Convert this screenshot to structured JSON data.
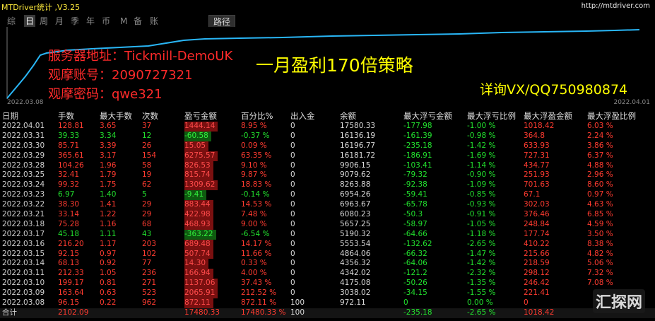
{
  "window": {
    "title": "MTDriver统计 ,V3.25",
    "url": "http://mtdriver.com"
  },
  "tabs": [
    "综",
    "日",
    "周",
    "月",
    "季",
    "年",
    "币",
    "M",
    "备",
    "账户"
  ],
  "active_tab": 1,
  "path_button": "路径",
  "overlay": {
    "server": "服务器地址：Tickmill-DemoUK",
    "account": "观摩账号：2090727321",
    "password": "观摩密码：qwe321",
    "headline": "一月盈利170倍策略",
    "contact": "详询VX/QQ750980874"
  },
  "equity_chart": {
    "start_date": "2022.03.08",
    "end_date": "2022.04.01",
    "line_color": "#29b6f6"
  },
  "table": {
    "headers": [
      "日期",
      "手数",
      "最大手数",
      "次数",
      "盈亏金额",
      "百分比%",
      "出入金",
      "余额",
      "最大浮亏金额",
      "最大浮亏比例",
      "最大浮盈金额",
      "最大浮盈比例"
    ],
    "rows": [
      [
        "2022.04.01",
        "128.81",
        "3.65",
        "37",
        "1444.14",
        "8.95 %",
        "0",
        "17580.33",
        "-177.98",
        "-1.00 %",
        "1018.42",
        "6.03 %"
      ],
      [
        "2022.03.31",
        "39.33",
        "3.34",
        "12",
        "-60.58",
        "-0.37 %",
        "0",
        "16136.19",
        "-161.39",
        "-0.98 %",
        "364.8",
        "2.24 %"
      ],
      [
        "2022.03.30",
        "85.71",
        "3.39",
        "26",
        "15.05",
        "0.09 %",
        "0",
        "16196.77",
        "-235.18",
        "-1.42 %",
        "633.93",
        "3.86 %"
      ],
      [
        "2022.03.29",
        "365.61",
        "3.17",
        "154",
        "6275.57",
        "63.35 %",
        "0",
        "16181.72",
        "-186.91",
        "-1.69 %",
        "727.31",
        "6.37 %"
      ],
      [
        "2022.03.28",
        "104.26",
        "1.96",
        "58",
        "826.53",
        "9.10 %",
        "0",
        "9906.15",
        "-103.41",
        "-1.14 %",
        "434.77",
        "4.88 %"
      ],
      [
        "2022.03.25",
        "32.41",
        "1.79",
        "19",
        "815.74",
        "9.87 %",
        "0",
        "9079.62",
        "-79.32",
        "-0.90 %",
        "251.93",
        "2.96 %"
      ],
      [
        "2022.03.24",
        "99.32",
        "1.75",
        "62",
        "1309.62",
        "18.83 %",
        "0",
        "8263.88",
        "-92.38",
        "-1.09 %",
        "701.63",
        "8.60 %"
      ],
      [
        "2022.03.23",
        "6.97",
        "1.40",
        "5",
        "-9.41",
        "-0.14 %",
        "0",
        "6954.26",
        "-59.41",
        "-0.85 %",
        "67.1",
        "0.97 %"
      ],
      [
        "2022.03.22",
        "38.30",
        "1.41",
        "29",
        "883.44",
        "14.53 %",
        "0",
        "6963.67",
        "-65.78",
        "-0.93 %",
        "302.03",
        "4.63 %"
      ],
      [
        "2022.03.21",
        "33.14",
        "1.22",
        "29",
        "422.98",
        "7.48 %",
        "0",
        "6080.23",
        "-50.3",
        "-0.91 %",
        "376.46",
        "6.85 %"
      ],
      [
        "2022.03.18",
        "75.28",
        "1.16",
        "68",
        "468.93",
        "9.00 %",
        "0",
        "5657.25",
        "-58.97",
        "-1.05 %",
        "248.84",
        "4.59 %"
      ],
      [
        "2022.03.17",
        "45.18",
        "1.11",
        "43",
        "-363.22",
        "-6.54 %",
        "0",
        "5190.32",
        "-64.66",
        "-1.18 %",
        "177.74",
        "3.50 %"
      ],
      [
        "2022.03.16",
        "216.20",
        "1.17",
        "203",
        "689.48",
        "14.17 %",
        "0",
        "5553.54",
        "-132.62",
        "-2.65 %",
        "410.22",
        "8.38 %"
      ],
      [
        "2022.03.15",
        "92.15",
        "0.97",
        "102",
        "507.74",
        "11.66 %",
        "0",
        "4864.06",
        "-66.32",
        "-1.47 %",
        "215.66",
        "4.82 %"
      ],
      [
        "2022.03.14",
        "68.13",
        "0.92",
        "77",
        "14.30",
        "0.33 %",
        "0",
        "4356.32",
        "-64.06",
        "-1.42 %",
        "218.59",
        "5.06 %"
      ],
      [
        "2022.03.11",
        "212.33",
        "1.05",
        "236",
        "166.94",
        "4.00 %",
        "0",
        "4342.02",
        "-121.2",
        "-2.32 %",
        "298.12",
        "7.32 %"
      ],
      [
        "2022.03.10",
        "199.17",
        "0.81",
        "271",
        "1137.06",
        "37.43 %",
        "0",
        "4175.08",
        "-50.26",
        "-1.35 %",
        "246.42",
        "7.08 %"
      ],
      [
        "2022.03.09",
        "163.64",
        "0.63",
        "523",
        "2065.91",
        "212.52 %",
        "0",
        "3038.02",
        "-34.15",
        "-1.55 %",
        "221.41",
        ""
      ],
      [
        "2022.03.08",
        "96.15",
        "0.22",
        "962",
        "872.11",
        "872.11 %",
        "100",
        "972.11",
        "0",
        "0.00 %",
        "0",
        ""
      ]
    ],
    "total": [
      "合计",
      "2102.09",
      "",
      "",
      "17480.33",
      "17480.33 %",
      "100",
      "",
      "-235.18",
      "-2.65 %",
      "1018.42",
      ""
    ]
  },
  "watermark": "汇探网",
  "colors": {
    "loss": "#ff3b30",
    "profit": "#22e02e",
    "title": "#ffeb3b"
  }
}
